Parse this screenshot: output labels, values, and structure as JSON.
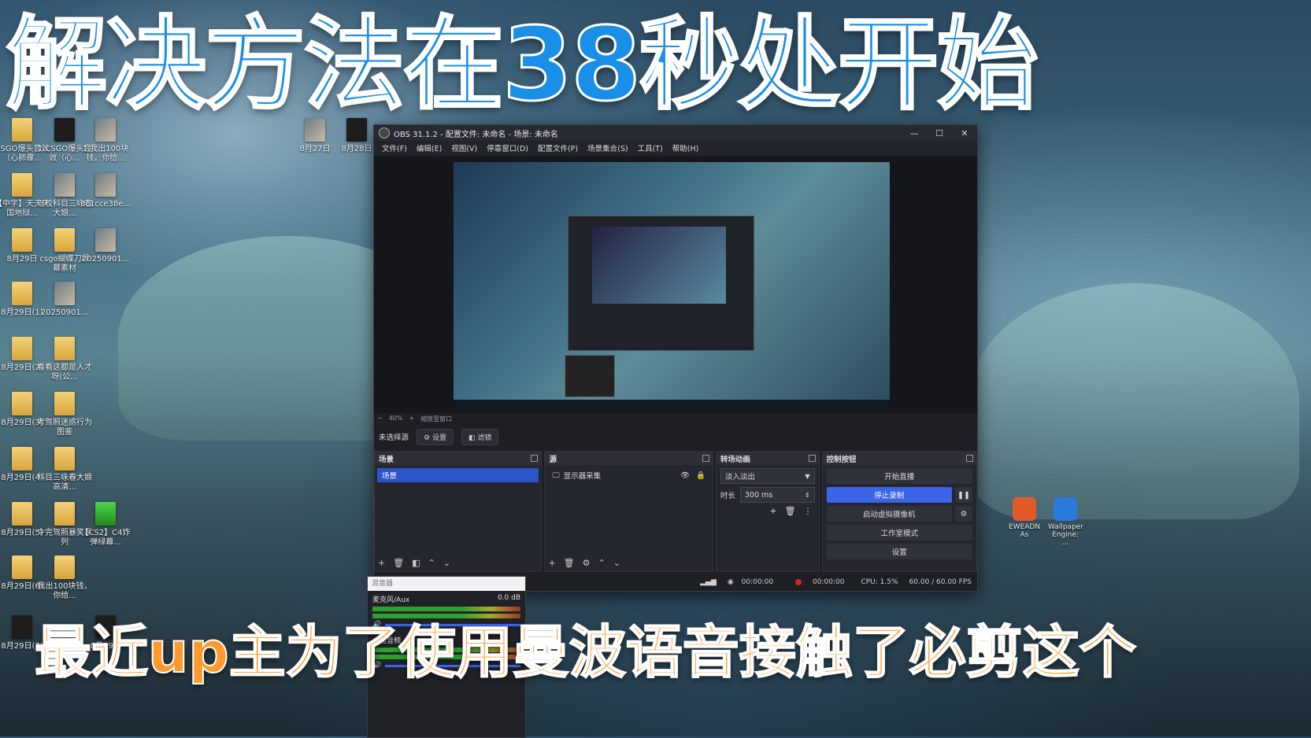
{
  "overlay": {
    "headline": "解决方法在38秒处开始",
    "subtitle": "最近up主为了使用曼波语音接触了必剪这个"
  },
  "desktop": {
    "icons_left": [
      {
        "label": "CSGO爆头音效（心肺骤...",
        "kind": "folder"
      },
      {
        "label": "1.CSGO爆头音效（心...",
        "kind": "dark"
      },
      {
        "label": "1.我出100块钱，你给...",
        "kind": "img"
      },
      {
        "label": "8月27日",
        "kind": "img"
      },
      {
        "label": "8月28日",
        "kind": "dark"
      },
      {
        "label": "【中字】天天天国地狱...",
        "kind": "folder"
      },
      {
        "label": "驾校科目三咏春大娘...",
        "kind": "img"
      },
      {
        "label": "8c1cce38e...",
        "kind": "img"
      },
      {
        "label": "8月29日",
        "kind": "folder"
      },
      {
        "label": "csgo蝴蝶刀绿幕素材",
        "kind": "folder"
      },
      {
        "label": "20250901...",
        "kind": "img"
      },
      {
        "label": "8月29日(1)",
        "kind": "folder"
      },
      {
        "label": "20250901...",
        "kind": "img"
      },
      {
        "label": "8月29日(2)",
        "kind": "folder"
      },
      {
        "label": "看看这都是人才呀(公...",
        "kind": "folder"
      },
      {
        "label": "8月29日(3)",
        "kind": "folder"
      },
      {
        "label": "考驾照迷惑行为图鉴",
        "kind": "folder"
      },
      {
        "label": "8月29日(4)",
        "kind": "folder"
      },
      {
        "label": "科目三咏春大娘高清...",
        "kind": "folder"
      },
      {
        "label": "8月29日(5)",
        "kind": "folder"
      },
      {
        "label": "令完驾照暴笑系列",
        "kind": "folder"
      },
      {
        "label": "【CS2】C4炸弹绿幕...",
        "kind": "green"
      },
      {
        "label": "8月29日(6)",
        "kind": "folder"
      },
      {
        "label": "我出100块钱，你给...",
        "kind": "folder"
      },
      {
        "label": "8月29日(7)",
        "kind": "dark"
      },
      {
        "label": "8月29...",
        "kind": "dark"
      }
    ],
    "icons_right": [
      {
        "label": "EWEADN As",
        "color": "#e05a2a"
      },
      {
        "label": "Wallpaper Engine: ...",
        "color": "#2a7ae0"
      }
    ]
  },
  "obs": {
    "title": "OBS 31.1.2 - 配置文件: 未命名 - 场景: 未命名",
    "window_controls": [
      "—",
      "☐",
      "✕"
    ],
    "menu": [
      "文件(F)",
      "编辑(E)",
      "视图(V)",
      "停靠窗口(D)",
      "配置文件(P)",
      "场景集合(S)",
      "工具(T)",
      "帮助(H)"
    ],
    "zoom": {
      "minus": "−",
      "value": "40%",
      "plus": "+",
      "mode": "缩放至窗口"
    },
    "source_bar": {
      "no_source": "未选择源",
      "settings": "设置",
      "filters": "滤镜"
    },
    "scenes": {
      "header": "场景",
      "items": [
        "场景"
      ]
    },
    "sources": {
      "header": "源",
      "items": [
        "显示器采集"
      ]
    },
    "transitions": {
      "header": "转场动画",
      "type": "淡入淡出",
      "duration_label": "时长",
      "duration": "300 ms"
    },
    "controls": {
      "header": "控制按钮",
      "start_stream": "开始直播",
      "stop_record": "停止录制",
      "virtual_cam": "启动虚拟摄像机",
      "studio_mode": "工作室模式",
      "settings": "设置"
    },
    "status": {
      "stream_time": "00:00:00",
      "rec_time": "00:00:00",
      "cpu": "CPU: 1.5%",
      "fps": "60.00 / 60.00 FPS"
    }
  },
  "mixer": {
    "header": "混音器",
    "channels": [
      {
        "name": "麦克风/Aux",
        "db": "0.0 dB"
      },
      {
        "name": "桌面音频",
        "db": ""
      }
    ]
  },
  "colors": {
    "accent": "#3c64e6",
    "headline": "#1a8fe8",
    "subtitle": "#ff9a2e"
  }
}
